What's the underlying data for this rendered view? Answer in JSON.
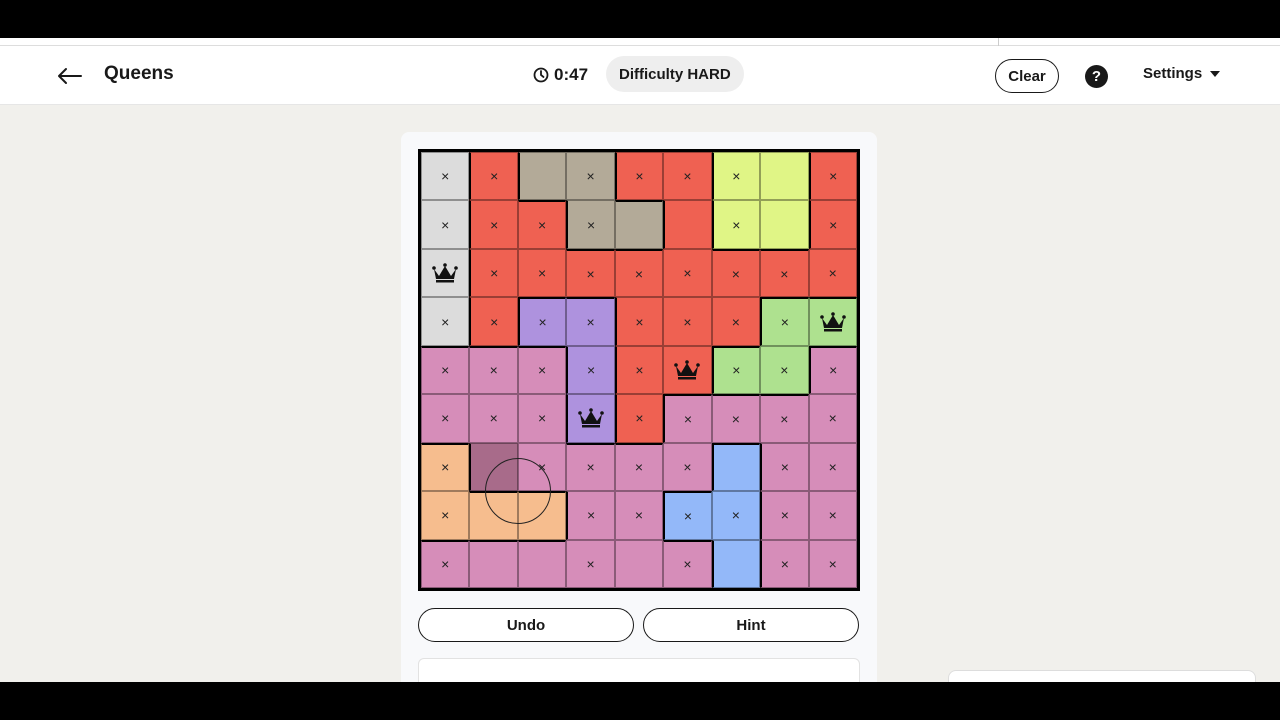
{
  "header": {
    "title": "Queens",
    "timer": "0:47",
    "difficulty": "Difficulty HARD",
    "clear_label": "Clear",
    "help_label": "?",
    "settings_label": "Settings"
  },
  "controls": {
    "undo_label": "Undo",
    "hint_label": "Hint"
  },
  "colors": {
    "A": "#dcdcdc",
    "R": "#ef6152",
    "T": "#b3aa98",
    "Y": "#e0f586",
    "P": "#ae92de",
    "G": "#aee18f",
    "K": "#d68db9",
    "O": "#f6bd8e",
    "B": "#93b8f9",
    "hover": "#a86b8a"
  },
  "board": {
    "regions": [
      "ARTTRRYYR",
      "ARRTTRYYR",
      "ARRRRRRRR",
      "ARPPRRRGG",
      "KKKPRRGGK",
      "KKKPRKKKK",
      "OKKKKKBKK",
      "OOOKKBBKK",
      "KKKKKKBKK"
    ],
    "marks": [
      "xx.xxxx.x",
      "xxxx..x.x",
      "qxxxxxxxx",
      "xxxxxxxxq",
      "xxxxxqxxx",
      "xxxqxxxxx",
      "x.xxxx.xx",
      "x..xxxxxx",
      "x..x.x.xx"
    ],
    "hover_cell": [
      6,
      1
    ]
  }
}
